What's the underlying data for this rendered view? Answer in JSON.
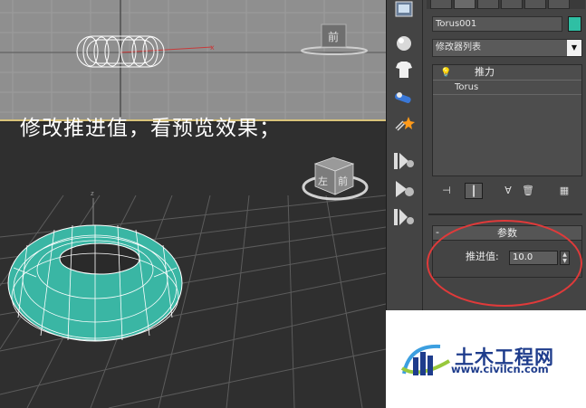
{
  "caption": "修改推进值，看预览效果；",
  "viewcube_top_label": "前",
  "viewcube_persp_labels": [
    "左",
    "前"
  ],
  "panel": {
    "object_name": "Torus001",
    "object_color": "#2fbfa4",
    "modifier_list": "修改器列表",
    "modifier_stack": [
      {
        "label": "推力",
        "icon": "lightbulb-icon"
      },
      {
        "label": "Torus"
      }
    ],
    "rollout_title": "参数",
    "rollout_toggle": "-",
    "push_label": "推进值:",
    "push_value": "10.0"
  },
  "toolbar_icons": [
    "bulb-icon",
    "tshirt-icon",
    "pipe-icon",
    "star-sparkle-icon",
    "play-gear-icon",
    "play-gear-icon",
    "play-gear-icon"
  ],
  "watermark": {
    "title": "土木工程网",
    "url": "www.civilcn.com"
  },
  "colors": {
    "torus": "#2fbfa4",
    "highlight_ring": "#e03a3a",
    "watermark_blue": "#1e3c8c"
  }
}
